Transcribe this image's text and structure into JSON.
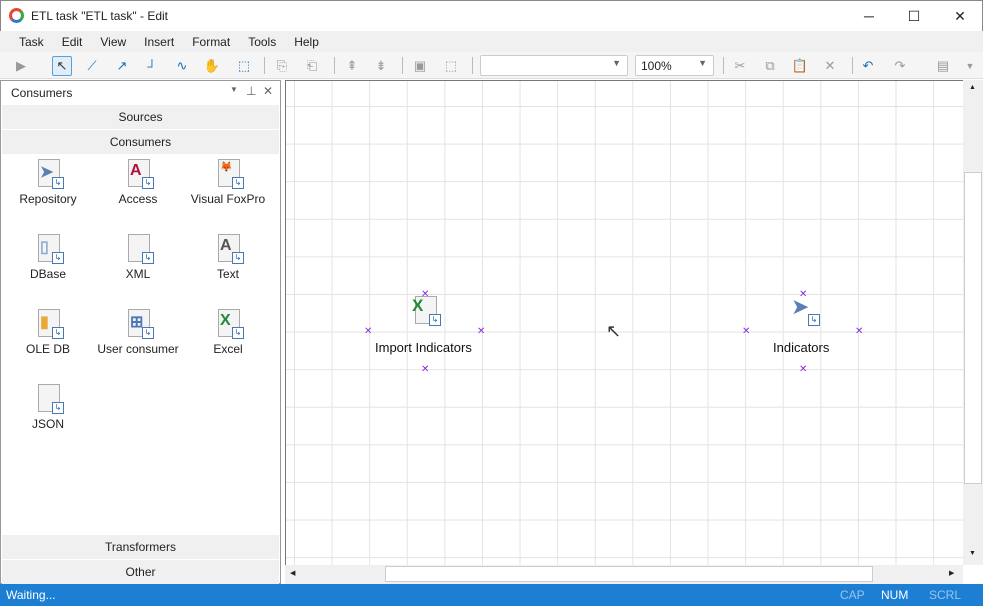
{
  "window": {
    "title": "ETL task \"ETL task\" - Edit"
  },
  "menu": [
    "Task",
    "Edit",
    "View",
    "Insert",
    "Format",
    "Tools",
    "Help"
  ],
  "toolbar": {
    "zoom": "100%",
    "style_value": ""
  },
  "panel": {
    "title": "Consumers",
    "groups": {
      "sources": "Sources",
      "consumers": "Consumers",
      "transformers": "Transformers",
      "other": "Other"
    },
    "items": [
      {
        "label": "Repository",
        "icon": "paper-plane"
      },
      {
        "label": "Access",
        "icon": "access"
      },
      {
        "label": "Visual FoxPro",
        "icon": "fox"
      },
      {
        "label": "DBase",
        "icon": "database"
      },
      {
        "label": "XML",
        "icon": "xml"
      },
      {
        "label": "Text",
        "icon": "text"
      },
      {
        "label": "OLE DB",
        "icon": "cylinder"
      },
      {
        "label": "User consumer",
        "icon": "flowchart"
      },
      {
        "label": "Excel",
        "icon": "excel"
      },
      {
        "label": "JSON",
        "icon": "json"
      }
    ]
  },
  "canvas": {
    "nodes": [
      {
        "label": "Import Indicators",
        "icon": "excel"
      },
      {
        "label": "Indicators",
        "icon": "paper-plane"
      }
    ]
  },
  "status": {
    "text": "Waiting...",
    "cap": "CAP",
    "num": "NUM",
    "scrl": "SCRL"
  },
  "colors": {
    "accent": "#1c7fd4"
  }
}
